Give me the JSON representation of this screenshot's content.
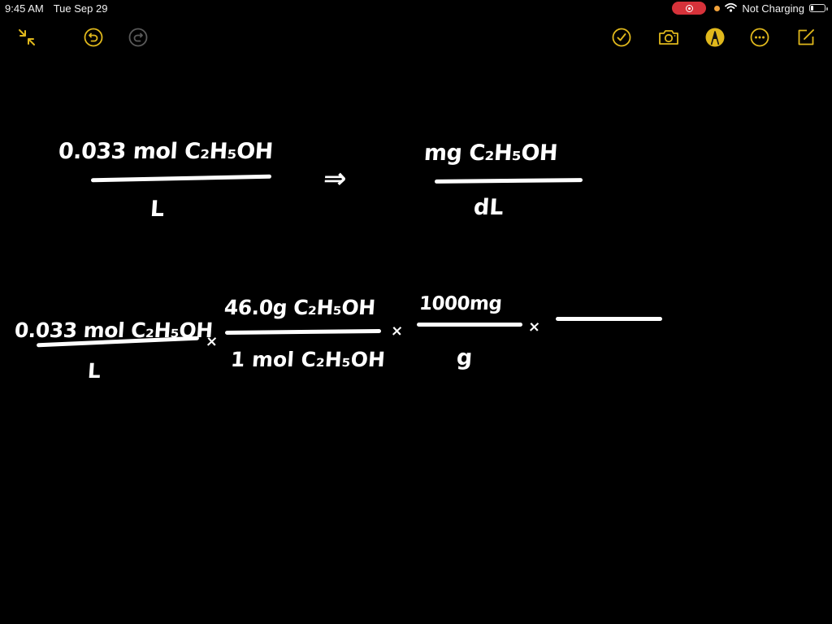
{
  "status_bar": {
    "time": "9:45 AM",
    "date": "Tue Sep 29",
    "recording_indicator": "screen-recording",
    "battery_text": "Not Charging",
    "battery_level": 0.2,
    "colors": {
      "recording": "#d6323a",
      "mic_dot": "#f2a23a"
    }
  },
  "toolbar": {
    "accent_color": "#e0b81c",
    "left": [
      {
        "name": "collapse",
        "icon": "arrows-inward-icon"
      },
      {
        "name": "undo",
        "icon": "undo-icon"
      },
      {
        "name": "redo",
        "icon": "redo-icon",
        "disabled": true
      }
    ],
    "right": [
      {
        "name": "checklist",
        "icon": "checkmark-circle-icon"
      },
      {
        "name": "camera",
        "icon": "camera-icon"
      },
      {
        "name": "markup",
        "icon": "pen-tip-icon",
        "active": true
      },
      {
        "name": "more",
        "icon": "ellipsis-circle-icon"
      },
      {
        "name": "compose",
        "icon": "compose-icon"
      }
    ]
  },
  "note": {
    "line1": {
      "left_fraction": {
        "numerator": "0.033 mol C₂H₅OH",
        "denominator": "L"
      },
      "arrow": "⇒",
      "right_fraction": {
        "numerator": "mg C₂H₅OH",
        "denominator": "dL"
      }
    },
    "line2": {
      "fractions": [
        {
          "numerator": "0.033 mol C₂H₅OH",
          "denominator": "L"
        },
        {
          "numerator": "46.0g C₂H₅OH",
          "denominator": "1 mol C₂H₅OH"
        },
        {
          "numerator": "1000mg",
          "denominator": "g"
        },
        {
          "numerator": "",
          "denominator": ""
        }
      ],
      "operator": "×"
    }
  }
}
